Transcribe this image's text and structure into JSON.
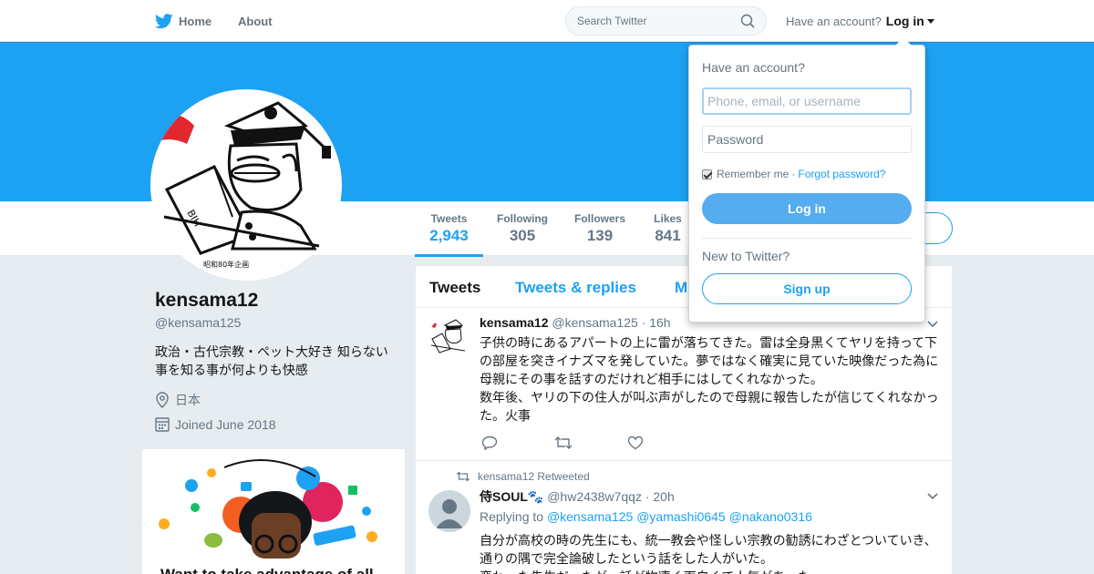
{
  "header": {
    "home_label": "Home",
    "about_label": "About",
    "search_placeholder": "Search Twitter",
    "account_prompt": "Have an account?",
    "login_label": "Log in"
  },
  "profile": {
    "name": "kensama12",
    "handle": "@kensama125",
    "bio": "政治・古代宗教・ペット大好き 知らない事を知る事が何よりも快感",
    "location": "日本",
    "joined": "Joined June 2018",
    "avatar_caption": "昭和80年企画",
    "stats": [
      {
        "label": "Tweets",
        "value": "2,943"
      },
      {
        "label": "Following",
        "value": "305"
      },
      {
        "label": "Followers",
        "value": "139"
      },
      {
        "label": "Likes",
        "value": "841"
      }
    ]
  },
  "promo": {
    "headline": "Want to take advantage of all"
  },
  "timeline": {
    "tabs": [
      "Tweets",
      "Tweets & replies",
      "M"
    ],
    "tweets": [
      {
        "name": "kensama12",
        "handle": "@kensama125",
        "time": "· 16h",
        "text": "子供の時にあるアパートの上に雷が落ちてきた。雷は全身黒くてヤリを持って下の部屋を突きイナズマを発していた。夢ではなく確実に見ていた映像だった為に母親にその事を話すのだけれど相手にはしてくれなかった。\n数年後、ヤリの下の住人が叫ぶ声がしたので母親に報告したが信じてくれなかった。火事"
      },
      {
        "retweeted_by": "kensama12 Retweeted",
        "name": "侍SOUL🐾",
        "handle": "@hw2438w7qqz",
        "time": "· 20h",
        "replying_prefix": "Replying to",
        "replying_to": [
          "@kensama125",
          "@yamashi0645",
          "@nakano0316"
        ],
        "text": "自分が高校の時の先生にも、統一教会や怪しい宗教の勧誘にわざとついていき、通りの隅で完全論破したという話をした人がいた。\n変わった先生だったが、話が物凄く面白くて人気があった"
      }
    ]
  },
  "login_dropdown": {
    "title": "Have an account?",
    "username_placeholder": "Phone, email, or username",
    "password_placeholder": "Password",
    "remember_label": "Remember me",
    "separator": "·",
    "forgot_label": "Forgot password?",
    "login_button": "Log in",
    "new_prompt": "New to Twitter?",
    "signup_button": "Sign up"
  },
  "colors": {
    "brand": "#1da1f2",
    "banner": "#1da1f2",
    "login_button": "#55acee",
    "background": "#e6ecf0"
  }
}
